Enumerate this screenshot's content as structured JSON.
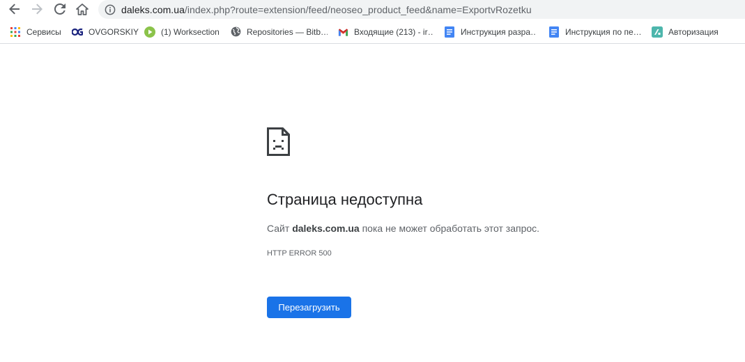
{
  "toolbar": {
    "back_icon": "arrow-left-icon",
    "forward_icon": "arrow-right-icon",
    "reload_icon": "reload-icon",
    "home_icon": "home-icon",
    "info_icon": "info-icon",
    "url_host": "daleks.com.ua",
    "url_path": "/index.php?route=extension/feed/neoseo_product_feed&name=ExportvRozetku"
  },
  "bookmarks": [
    {
      "label": "Сервисы",
      "icon": "apps-grid-icon"
    },
    {
      "label": "OVGORSKIY",
      "icon": "ovgorskiy-logo-icon"
    },
    {
      "label": "(1) Worksection",
      "icon": "worksection-icon"
    },
    {
      "label": "Repositories — Bitb…",
      "icon": "globe-icon"
    },
    {
      "label": "Входящие (213) - ir…",
      "icon": "gmail-icon"
    },
    {
      "label": "Инструкция разра…",
      "icon": "google-docs-icon"
    },
    {
      "label": "Инструкция по пе…",
      "icon": "google-docs-icon"
    },
    {
      "label": "Авторизация",
      "icon": "sheets-icon"
    }
  ],
  "error": {
    "icon": "sad-page-icon",
    "title": "Страница недоступна",
    "desc_prefix": "Сайт ",
    "desc_host": "daleks.com.ua",
    "desc_suffix": " пока не может обработать этот запрос.",
    "code": "HTTP ERROR 500",
    "reload_label": "Перезагрузить"
  },
  "colors": {
    "accent": "#1a73e8",
    "omnibox_bg": "#f1f3f4",
    "text_primary": "#202124",
    "text_secondary": "#5f6368"
  }
}
